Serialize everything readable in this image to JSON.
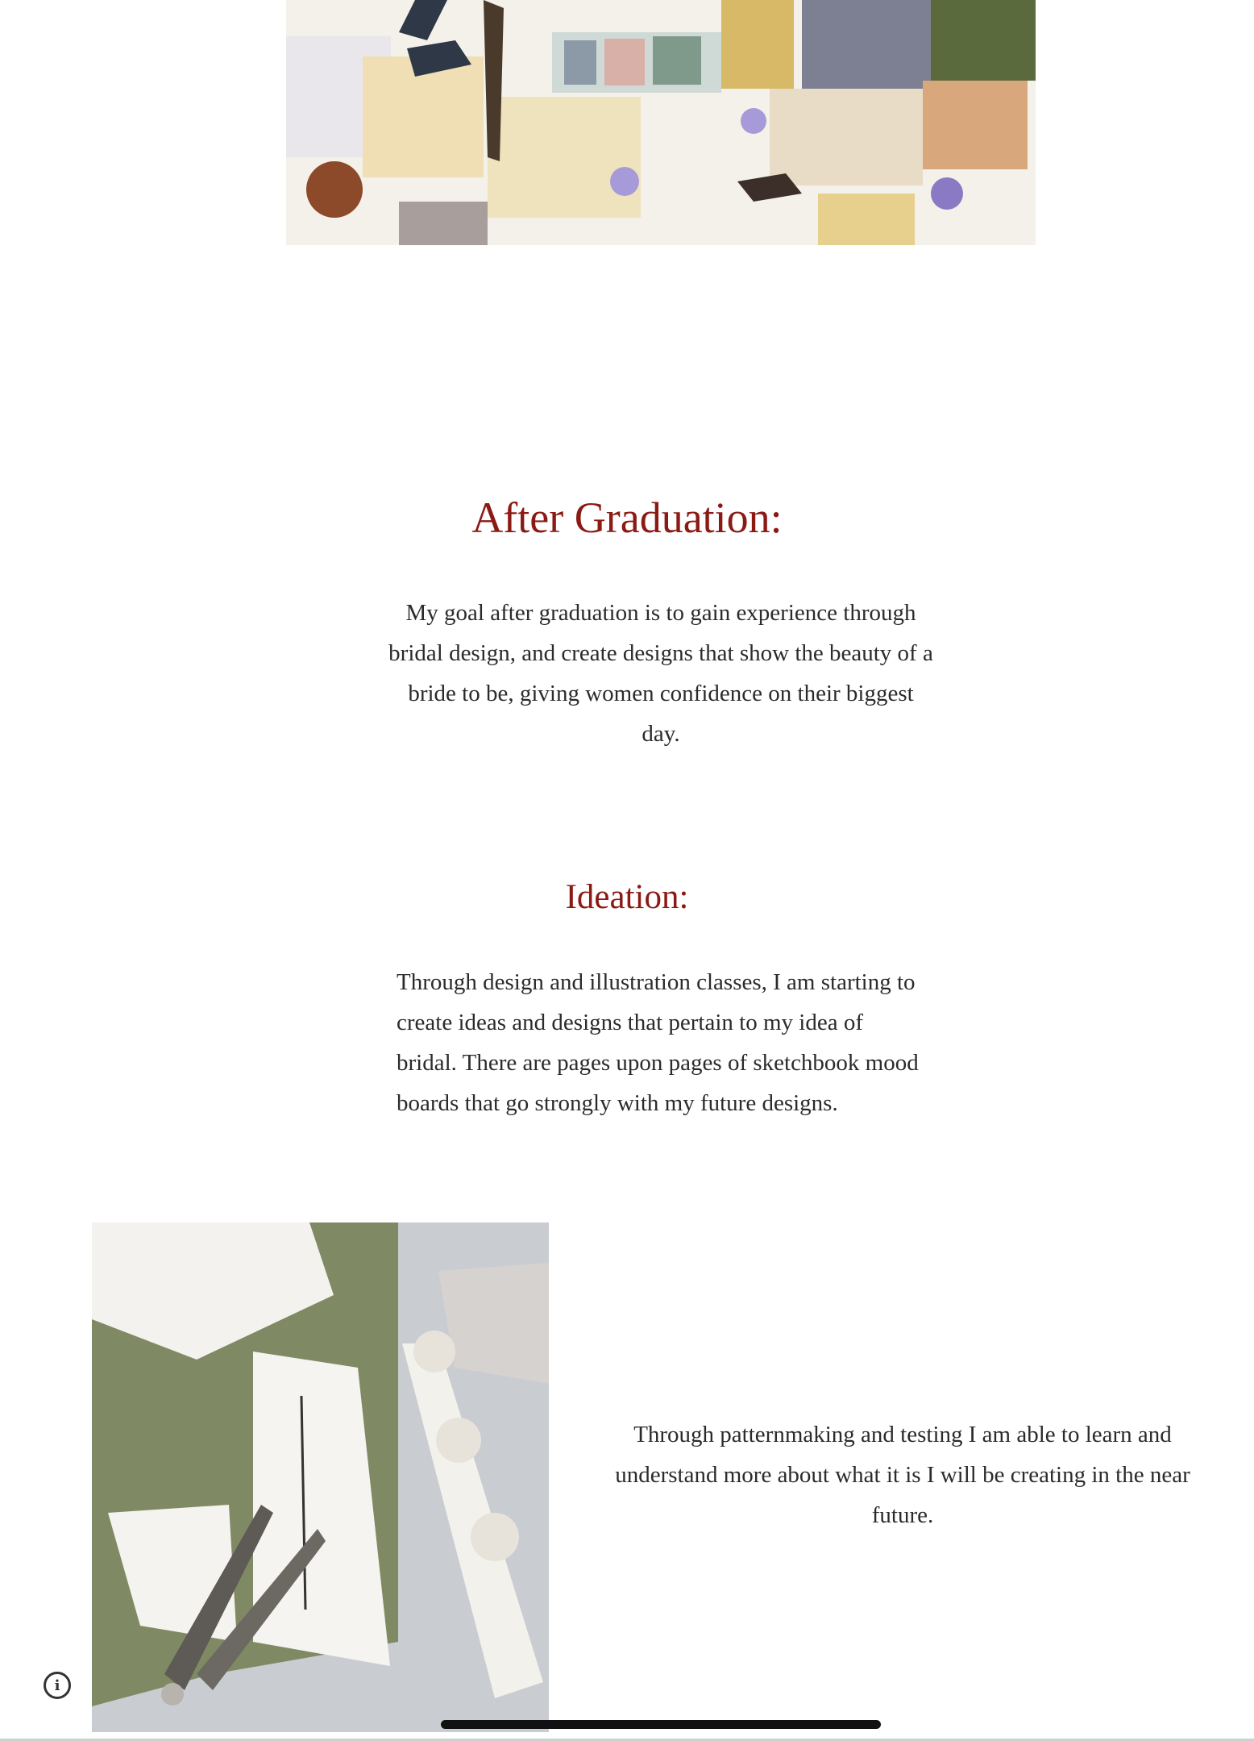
{
  "colors": {
    "heading": "#8b1a14",
    "body_text": "#2b2b2b",
    "background": "#ffffff"
  },
  "collage_image": {
    "alt": "Mood board collage"
  },
  "after_graduation": {
    "heading": "After Graduation:",
    "body": "My goal after graduation is to gain experience through bridal design, and create designs that show the beauty of a bride to be, giving women confidence on their biggest day."
  },
  "ideation": {
    "heading": "Ideation:",
    "body": "Through design and illustration classes, I am starting to create ideas and designs that pertain to my idea of bridal. There are pages upon pages of sketchbook mood boards that go strongly with my future designs."
  },
  "patternmaking": {
    "image_alt": "Paper patterns with scissors and pattern weights",
    "body": "Through patternmaking and testing I am able to learn and understand more about what it is I will be creating in the near future."
  },
  "info_button": {
    "icon": "info-icon",
    "glyph": "i"
  }
}
